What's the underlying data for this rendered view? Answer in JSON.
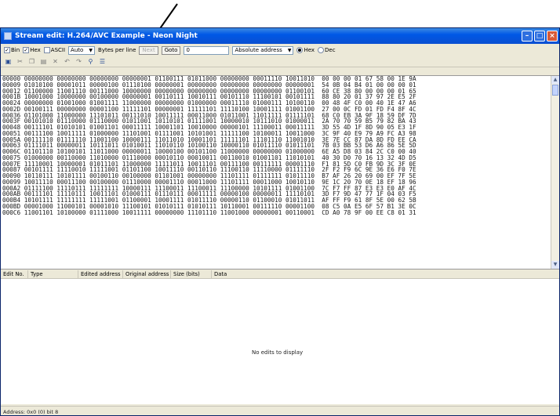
{
  "window": {
    "title": "Stream edit: H.264/AVC Example - Neon Night"
  },
  "options": {
    "bin_label": "Bin",
    "bin_checked": true,
    "hex_label": "Hex",
    "hex_checked": true,
    "ascii_label": "ASCII",
    "ascii_checked": false,
    "mode_value": "Auto",
    "bytes_label": "Bytes per line",
    "next_label": "Next",
    "goto_label": "Goto",
    "goto_value": "0",
    "address_mode_value": "Absolute address",
    "hex_radio_label": "Hex",
    "dec_radio_label": "Dec"
  },
  "hex_lines": [
    "00000 00000000 00000000 00000000 00000001 01100111 01011000 00000000 00011110 10011010  00 00 00 01 67 58 00 1E 9A",
    "00009 01010100 00001011 00000100 01110100 00000001 00000000 00000000 00000000 00000001  54 0B 04 B4 01 00 00 00 01",
    "00012 01100000 11001110 00111000 10000000 00000000 00000000 00000000 00000000 01100101  60 CE 38 80 00 00 00 01 65",
    "0001B 10001000 10000000 00100000 00000001 00110111 10010111 00101110 11100101 00101111  88 80 20 01 37 97 2E E5 2F",
    "00024 00000000 01001000 01001111 11000000 00000000 01000000 00011110 01000111 10100110  00 48 4F C0 00 40 1E 47 A6",
    "0002D 00100111 00000000 00001100 11111101 00000001 11111101 11110100 10001111 01001100  27 00 0C FD 01 FD F4 8F 4C",
    "00036 01101000 11000000 11101011 00111010 10011111 00011000 01011001 11011111 01111101  68 C0 EB 3A 9F 18 59 DF 7D",
    "0003F 00101010 01110000 01110000 01011001 10110101 01111001 10000010 10111010 01000011  2A 70 70 59 B5 79 82 BA 43",
    "00048 00111101 01010101 01001101 00011111 10001101 10010000 00000101 11100011 00011111  3D 55 4D 1F 8D 90 05 E3 1F",
    "00051 00111100 10011111 01000000 11101001 01111001 10101001 11111100 10100011 10011000  3C 9F 40 E9 79 A9 FC A3 98",
    "0005A 00111110 01111110 11001100 10000111 11011010 10001101 11111101 11101110 11001010  3E 7E CC 87 DA 8D FD EE CA",
    "00063 01111011 00000011 10111011 01010011 11010110 10100110 10000110 01011110 01011101  7B 03 BB 53 D6 A6 86 5E 5D",
    "0006C 01101110 10100101 11011000 00000011 10000100 00101100 11000000 00000000 01000000  6E A5 D8 03 84 2C C0 00 40",
    "00075 01000000 00110000 11010000 01110000 00010110 00010011 00110010 01001101 11010101  40 30 D0 70 16 13 32 4D D5",
    "0007E 11110001 10000001 01011101 11000000 11111011 10011101 00111100 00111111 00001110  F1 81 5D C0 FB 9D 3C 3F 0E",
    "00087 00101111 11110010 11111001 01101100 10011110 00110110 11100110 11110000 01111110  2F F2 F9 6C 9E 36 E6 F0 7E",
    "00090 10110111 10101111 00100110 00100000 01101001 00000000 11101111 01111111 01011110  B7 AF 26 20 69 00 EF 7F 5E",
    "00099 10011110 00011100 00100000 01110000 00001110 00011000 11101111 00011000 10010110  9E 1C 20 70 0E 18 EF 18 96",
    "000A2 01111100 11110111 11111111 10000111 11100011 11100011 11100000 10101111 01001100  7C F7 FF 87 E3 E3 E0 AF 4C",
    "000AB 00111101 11110111 10011101 01000111 01110111 00011111 00000100 00000011 11110101  3D F7 9D 47 77 1F 04 03 F5",
    "000B4 10101111 11111111 11111001 01100001 10001111 01011110 00000110 01100010 01011011  AF FF F9 61 8F 5E 00 62 5B",
    "000BD 00001000 11000101 00001010 11100101 01010111 01010111 10110001 00111110 00001100  08 C5 0A E5 6F 57 B1 3E 0C",
    "000C6 11001101 10100000 01111000 10011111 00000000 11101110 11001000 00000001 00110001  CD A0 78 9F 00 EE C8 01 31"
  ],
  "edits_table": {
    "columns": [
      "Edit No.",
      "Type",
      "Edited address",
      "Original address",
      "Size (bits)",
      "Data"
    ],
    "empty_message": "No edits to display"
  },
  "status": {
    "text": "Address: 0x0 (0) bit 8"
  },
  "icons": [
    "save-icon",
    "cut-icon",
    "copy-icon",
    "paste-icon",
    "delete-icon",
    "undo-icon",
    "redo-icon",
    "find-icon",
    "layout-icon"
  ]
}
